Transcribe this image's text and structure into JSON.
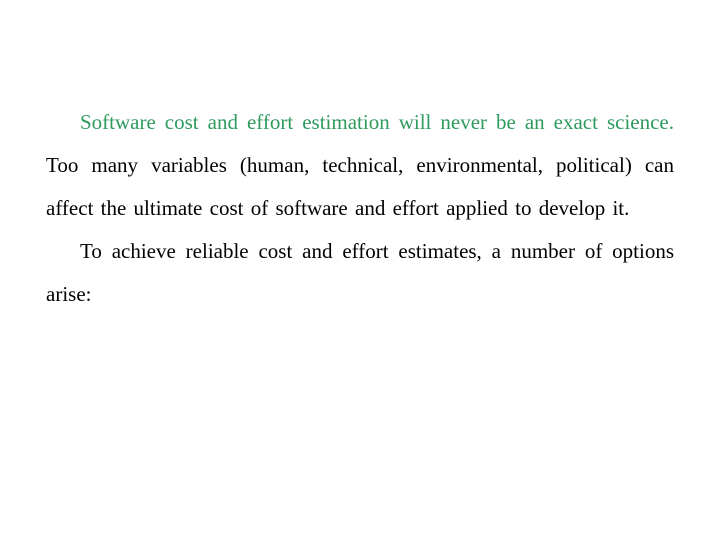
{
  "document": {
    "paragraphs": [
      {
        "highlight": "Software cost and effort estimation will never be an exact science.",
        "text": " Too many variables (human, technical, environmental, political) can affect the ultimate cost of software and effort applied to develop it."
      },
      {
        "text": "To achieve reliable cost and effort estimates, a number of options arise:"
      }
    ]
  },
  "colors": {
    "highlight": "#2e9a5e",
    "body_text": "#000000",
    "background": "#ffffff"
  }
}
